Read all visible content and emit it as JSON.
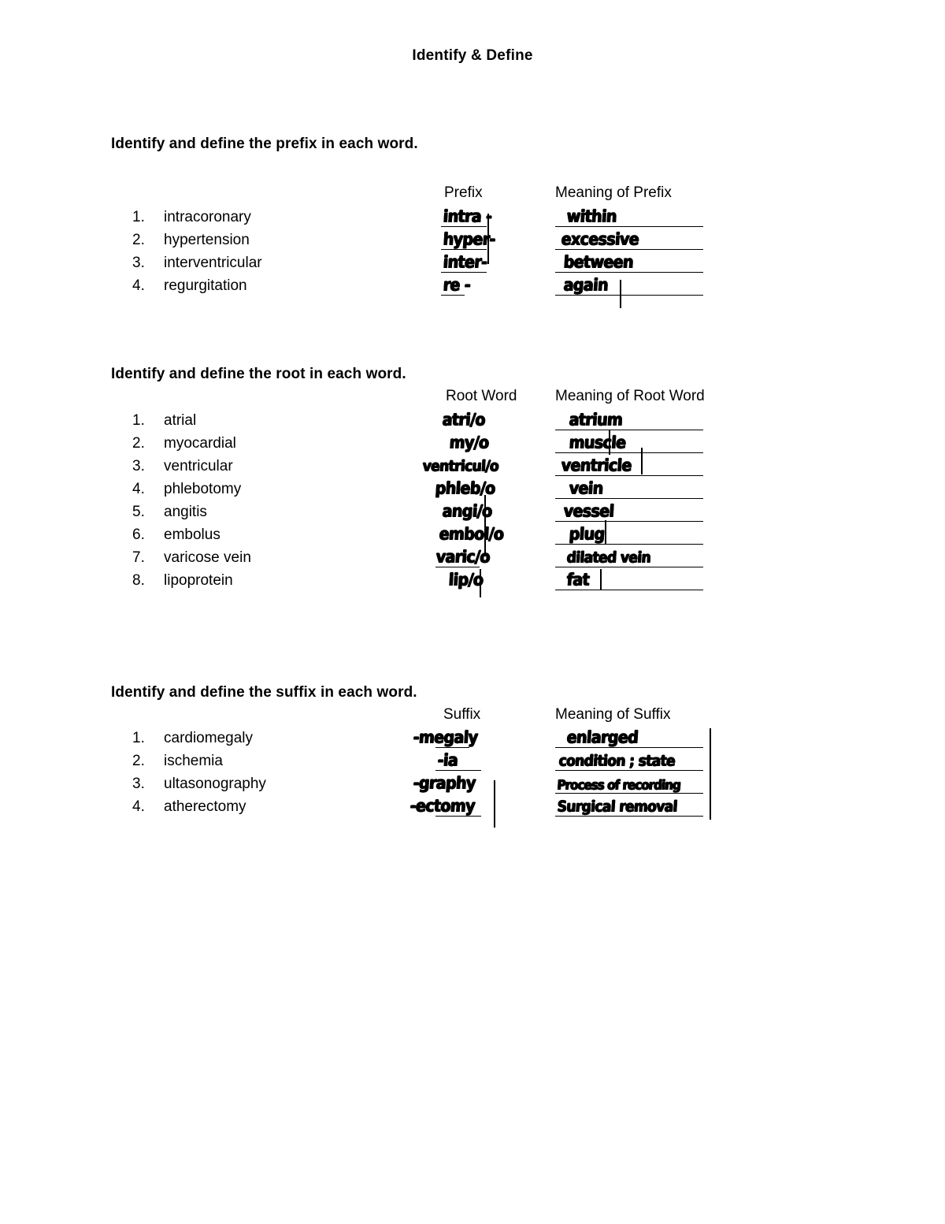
{
  "document": {
    "title": "Identify & Define"
  },
  "sections": [
    {
      "id": "prefix",
      "instruction": "Identify and define the prefix in each word.",
      "headers": {
        "term": "Prefix",
        "meaning": "Meaning of Prefix"
      },
      "items": [
        {
          "num": "1.",
          "word": "intracoronary",
          "answer": "intra -",
          "meaning": "within"
        },
        {
          "num": "2.",
          "word": "hypertension",
          "answer": "hyper-",
          "meaning": "excessive"
        },
        {
          "num": "3.",
          "word": "interventricular",
          "answer": "inter-",
          "meaning": "between"
        },
        {
          "num": "4.",
          "word": "regurgitation",
          "answer": "re  -",
          "meaning": "again"
        }
      ]
    },
    {
      "id": "root",
      "instruction": "Identify and define the root in each word.",
      "headers": {
        "term": "Root Word",
        "meaning": "Meaning of Root Word"
      },
      "items": [
        {
          "num": "1.",
          "word": "atrial",
          "answer": "atri/o",
          "meaning": "atrium"
        },
        {
          "num": "2.",
          "word": "myocardial",
          "answer": "my/o",
          "meaning": "muscle"
        },
        {
          "num": "3.",
          "word": "ventricular",
          "answer": "ventricul/o",
          "meaning": "ventricle"
        },
        {
          "num": "4.",
          "word": "phlebotomy",
          "answer": "phleb/o",
          "meaning": "vein"
        },
        {
          "num": "5.",
          "word": "angitis",
          "answer": "angi/o",
          "meaning": "vessel"
        },
        {
          "num": "6.",
          "word": "embolus",
          "answer": "embol/o",
          "meaning": "plug"
        },
        {
          "num": "7.",
          "word": "varicose vein",
          "answer": "varic/o",
          "meaning": "dilated vein"
        },
        {
          "num": "8.",
          "word": "lipoprotein",
          "answer": "lip/o",
          "meaning": "fat"
        }
      ]
    },
    {
      "id": "suffix",
      "instruction": "Identify and define the suffix in each word.",
      "headers": {
        "term": "Suffix",
        "meaning": "Meaning of Suffix"
      },
      "items": [
        {
          "num": "1.",
          "word": "cardiomegaly",
          "answer": "-megaly",
          "meaning": "enlarged"
        },
        {
          "num": "2.",
          "word": "ischemia",
          "answer": "-ia",
          "meaning": "condition ; state"
        },
        {
          "num": "3.",
          "word": "ultasonography",
          "answer": "-graphy",
          "meaning": "Process of recording"
        },
        {
          "num": "4.",
          "word": "atherectomy",
          "answer": "-ectomy",
          "meaning": "Surgical removal"
        }
      ]
    }
  ]
}
